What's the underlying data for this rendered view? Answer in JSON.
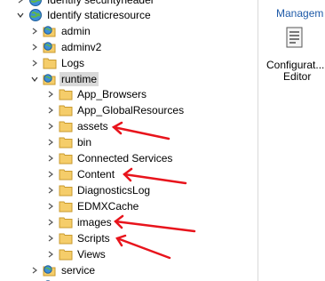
{
  "tree": {
    "partial_top_label": "Identify securityheader",
    "root_label": "Identify staticresource",
    "children": [
      {
        "label": "admin",
        "type": "application"
      },
      {
        "label": "adminv2",
        "type": "application"
      },
      {
        "label": "Logs",
        "type": "folder"
      },
      {
        "label": "runtime",
        "type": "application",
        "expanded": true,
        "selected": true
      }
    ],
    "runtime_children": [
      {
        "label": "App_Browsers"
      },
      {
        "label": "App_GlobalResources"
      },
      {
        "label": "assets",
        "annotated": true
      },
      {
        "label": "bin"
      },
      {
        "label": "Connected Services"
      },
      {
        "label": "Content",
        "annotated": true
      },
      {
        "label": "DiagnosticsLog"
      },
      {
        "label": "EDMXCache"
      },
      {
        "label": "images",
        "annotated": true
      },
      {
        "label": "Scripts",
        "annotated": true
      },
      {
        "label": "Views"
      }
    ],
    "after": {
      "label": "service",
      "type": "application"
    }
  },
  "right_pane": {
    "header": "Managem",
    "config_editor_line1": "Configurat...",
    "config_editor_line2": "Editor"
  },
  "colors": {
    "annotation_arrow": "#e8141c",
    "folder_fill": "#f5cd6a",
    "folder_stroke": "#c99a2e",
    "selection": "#d9d9d9",
    "header_link": "#1e5aa8"
  }
}
